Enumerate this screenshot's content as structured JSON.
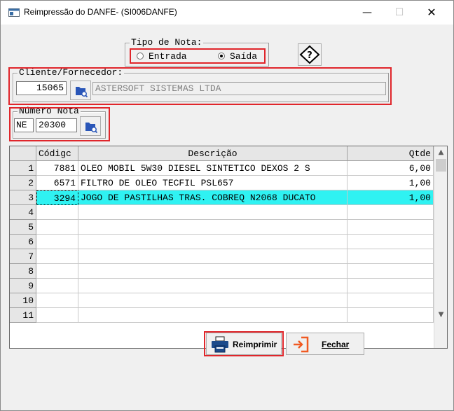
{
  "window": {
    "title": "Reimpressão do DANFE- (SI006DANFE)",
    "controls": {
      "minimize": "—",
      "maximize": "☐",
      "close": "✕"
    }
  },
  "tipo_nota": {
    "legend": "Tipo de Nota:",
    "options": [
      {
        "label": "Entrada",
        "selected": false
      },
      {
        "label": "Saída",
        "selected": true
      }
    ]
  },
  "cliente": {
    "legend": "Cliente/Fornecedor:",
    "code": "15065",
    "name": "ASTERSOFT SISTEMAS LTDA"
  },
  "numero_nota": {
    "legend": "Número Nota",
    "serie": "NE",
    "numero": "20300"
  },
  "grid": {
    "columns": [
      "",
      "Códigc",
      "Descrição",
      "Qtde"
    ],
    "rows": [
      {
        "n": "1",
        "codigo": "7881",
        "descricao": "OLEO MOBIL 5W30 DIESEL SINTETICO DEXOS 2 S",
        "qtde": "6,00"
      },
      {
        "n": "2",
        "codigo": "6571",
        "descricao": "FILTRO DE OLEO TECFIL PSL657",
        "qtde": "1,00"
      },
      {
        "n": "3",
        "codigo": "3294",
        "descricao": "JOGO DE PASTILHAS TRAS. COBREQ N2068 DUCATO",
        "qtde": "1,00"
      },
      {
        "n": "4",
        "codigo": "",
        "descricao": "",
        "qtde": ""
      },
      {
        "n": "5",
        "codigo": "",
        "descricao": "",
        "qtde": ""
      },
      {
        "n": "6",
        "codigo": "",
        "descricao": "",
        "qtde": ""
      },
      {
        "n": "7",
        "codigo": "",
        "descricao": "",
        "qtde": ""
      },
      {
        "n": "8",
        "codigo": "",
        "descricao": "",
        "qtde": ""
      },
      {
        "n": "9",
        "codigo": "",
        "descricao": "",
        "qtde": ""
      },
      {
        "n": "10",
        "codigo": "",
        "descricao": "",
        "qtde": ""
      },
      {
        "n": "11",
        "codigo": "",
        "descricao": "",
        "qtde": ""
      }
    ],
    "selected_row": 3
  },
  "buttons": {
    "reimprimir": "Reimprimir",
    "fechar": "Fechar"
  },
  "colors": {
    "highlight": "#e0262b",
    "selected_row": "#2ff2f2",
    "search_icon": "#2a56b8"
  }
}
